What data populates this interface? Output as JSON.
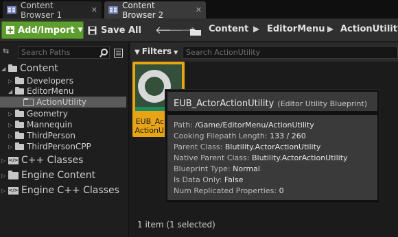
{
  "tabs": [
    {
      "label": "Content Browser 1",
      "active": false
    },
    {
      "label": "Content Browser 2",
      "active": true
    }
  ],
  "toolbar": {
    "add_import": "Add/Import",
    "save_all": "Save All",
    "breadcrumbs": [
      "Content",
      "EditorMenu",
      "ActionUtility"
    ]
  },
  "sidebar": {
    "search_placeholder": "Search Paths",
    "tree": [
      {
        "label": "Content"
      },
      {
        "label": "Developers"
      },
      {
        "label": "EditorMenu"
      },
      {
        "label": "ActionUtility"
      },
      {
        "label": "Geometry"
      },
      {
        "label": "Mannequin"
      },
      {
        "label": "ThirdPerson"
      },
      {
        "label": "ThirdPersonCPP"
      },
      {
        "label": "C++ Classes"
      },
      {
        "label": "Engine Content"
      },
      {
        "label": "Engine C++ Classes"
      }
    ]
  },
  "content": {
    "filters_label": "Filters",
    "search_placeholder": "Search ActionUtility",
    "asset": {
      "line1": "EUB_Ac",
      "line2": "ActionU"
    },
    "status": "1 item (1 selected)"
  },
  "tooltip": {
    "name": "EUB_ActorActionUtility",
    "type": "(Editor Utility Blueprint)",
    "rows": [
      {
        "key": "Path:",
        "value": "/Game/EditorMenu/ActionUtility"
      },
      {
        "key": "Cooking Filepath Length:",
        "value": "133 / 260"
      },
      {
        "key": "Parent Class:",
        "value": "Blutility.ActorActionUtility"
      },
      {
        "key": "Native Parent Class:",
        "value": "Blutility.ActorActionUtility"
      },
      {
        "key": "Blueprint Type:",
        "value": "Normal"
      },
      {
        "key": "Is Data Only:",
        "value": "False"
      },
      {
        "key": "Num Replicated Properties:",
        "value": "0"
      }
    ]
  },
  "colors": {
    "accent_green": "#5e9e2e",
    "asset_highlight": "#e7a414"
  },
  "icons": [
    "content-browser-tab-icon",
    "close-icon",
    "add-icon",
    "dropdown-arrow-icon",
    "save-icon",
    "back-arrow-icon",
    "forward-arrow-icon",
    "folder-icon",
    "search-icon",
    "view-options-icon",
    "filter-icon",
    "code-folder-icon"
  ]
}
